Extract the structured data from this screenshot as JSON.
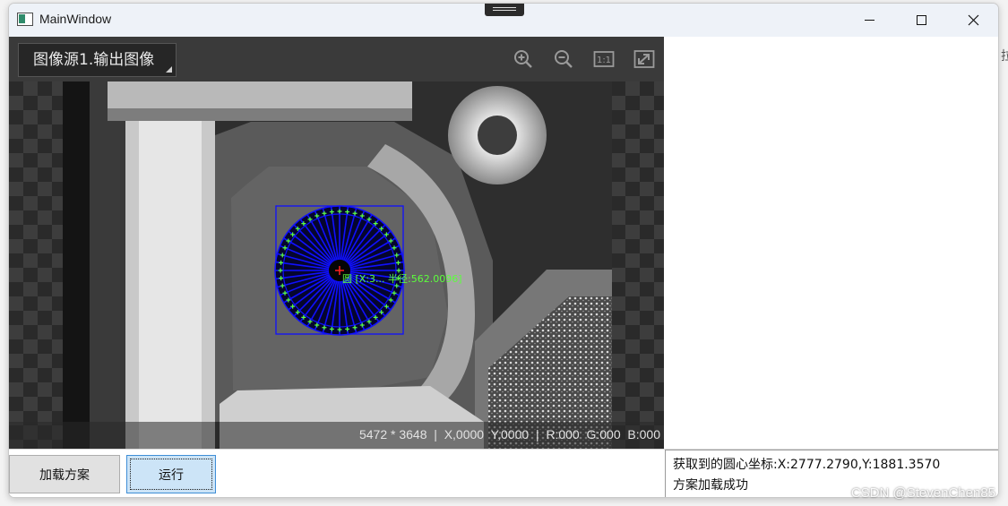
{
  "window": {
    "title": "MainWindow"
  },
  "viewer": {
    "source_label": "图像源1.输出图像",
    "tools": [
      "zoom-in-icon",
      "zoom-out-icon",
      "actual-size-icon",
      "fit-to-window-icon"
    ],
    "actual_size_label": "1:1",
    "status": "5472 * 3648  |  X,0000  Y,0000  |  R:000  G:000  B:000",
    "overlay_label": "圆 [X:3... 半径:562.0096]"
  },
  "buttons": {
    "load": "加载方案",
    "run": "运行"
  },
  "log": [
    "获取到的圆心坐标:X:2777.2790,Y:1881.3570",
    "方案加载成功"
  ],
  "watermark": "CSDN @StevenChen85",
  "right_edge_glyph": "拉",
  "colors": {
    "overlay_blue": "#1010ff",
    "overlay_green": "#5cff3c",
    "center_red": "#ff2020"
  }
}
